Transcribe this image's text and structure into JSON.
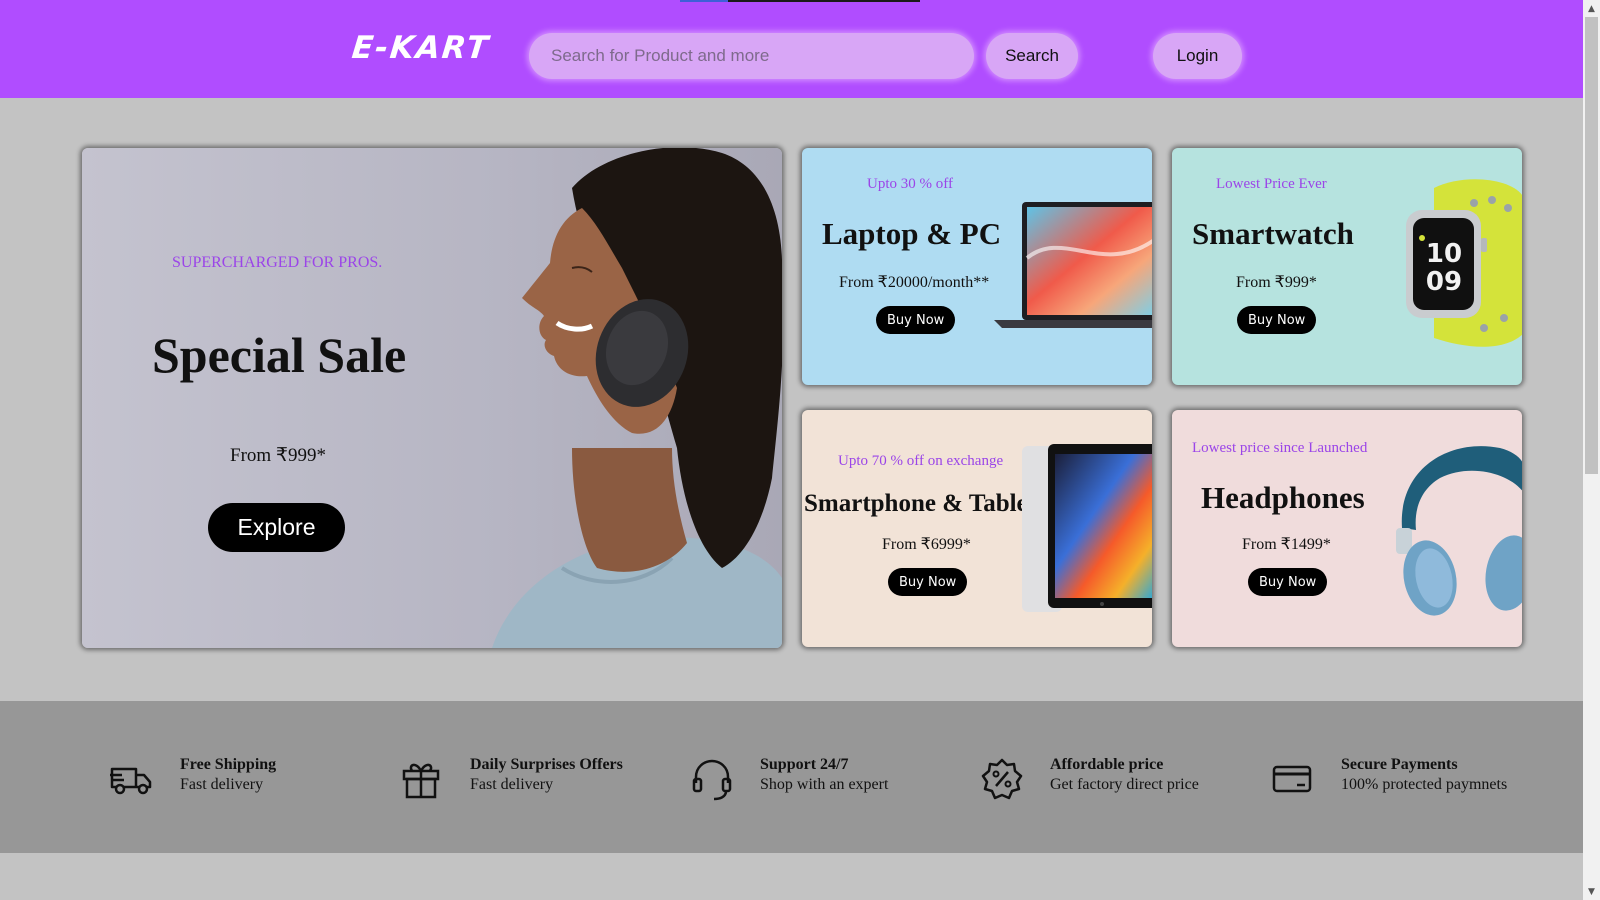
{
  "header": {
    "logo": "E-KART",
    "search_placeholder": "Search for Product and more",
    "search_button": "Search",
    "login_button": "Login"
  },
  "hero": {
    "tagline": "SUPERCHARGED FOR PROS.",
    "title": "Special Sale",
    "price": "From ₹999*",
    "cta": "Explore"
  },
  "cards": [
    {
      "tag": "Upto 30 % off",
      "title": "Laptop & PC",
      "price": "From ₹20000/month**",
      "cta": "Buy Now"
    },
    {
      "tag": "Lowest Price Ever",
      "title": "Smartwatch",
      "price": "From ₹999*",
      "cta": "Buy Now"
    },
    {
      "tag": "Upto 70 % off on exchange",
      "title": "Smartphone & Tablet",
      "price": "From ₹6999*",
      "cta": "Buy Now"
    },
    {
      "tag": "Lowest price since Launched",
      "title": "Headphones",
      "price": "From ₹1499*",
      "cta": "Buy Now"
    }
  ],
  "features": [
    {
      "icon": "truck-icon",
      "title": "Free Shipping",
      "subtitle": "Fast delivery"
    },
    {
      "icon": "gift-icon",
      "title": "Daily Surprises Offers",
      "subtitle": "Fast delivery"
    },
    {
      "icon": "headset-icon",
      "title": "Support 24/7",
      "subtitle": "Shop with an expert"
    },
    {
      "icon": "discount-badge-icon",
      "title": "Affordable price",
      "subtitle": "Get factory direct price"
    },
    {
      "icon": "credit-card-icon",
      "title": "Secure Payments",
      "subtitle": "100% protected paymnets"
    }
  ],
  "colors": {
    "header_bg": "#b04dff",
    "accent_purple": "#9b45e8",
    "features_bg": "#979797",
    "page_bg": "#c3c3c3"
  }
}
